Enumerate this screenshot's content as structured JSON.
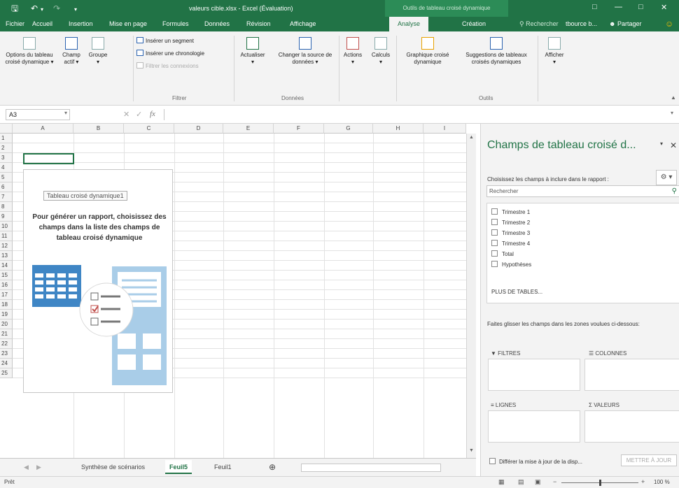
{
  "title": {
    "window_title": "valeurs cible.xlsx - Excel (Évaluation)",
    "contextual_label": "Outils de tableau croisé dynamique"
  },
  "tabs": [
    "Fichier",
    "Accueil",
    "Insertion",
    "Mise en page",
    "Formules",
    "Données",
    "Révision",
    "Affichage",
    "Analyse",
    "Création"
  ],
  "tell_me": "Rechercher",
  "user": "tbource b...",
  "share": "Partager",
  "ribbon": {
    "pivot_options": "Options du tableau croisé dynamique",
    "active_field": "Champ actif",
    "group": "Groupe",
    "insert_slicer": "Insérer un segment",
    "insert_timeline": "Insérer une chronologie",
    "filter_connections": "Filtrer les connexions",
    "filter_group": "Filtrer",
    "refresh": "Actualiser",
    "change_source": "Changer la source de données",
    "data_group": "Données",
    "actions": "Actions",
    "calculations": "Calculs",
    "pivot_chart": "Graphique croisé dynamique",
    "recommended": "Suggestions de tableaux croisés dynamiques",
    "tools_group": "Outils",
    "show": "Afficher"
  },
  "formula_bar": {
    "cell": "A3",
    "fx": "fx"
  },
  "columns": [
    "A",
    "B",
    "C",
    "D",
    "E",
    "F",
    "G",
    "H",
    "I"
  ],
  "rows": [
    "1",
    "2",
    "3",
    "4",
    "5",
    "6",
    "7",
    "8",
    "9",
    "10",
    "11",
    "12",
    "13",
    "14",
    "15",
    "16",
    "17",
    "18",
    "19",
    "20",
    "21",
    "22",
    "23",
    "24",
    "25"
  ],
  "pivot_placeholder": {
    "label": "Tableau croisé dynamique1",
    "instructions": "Pour générer un rapport, choisissez des champs dans la liste des champs de tableau croisé dynamique"
  },
  "sheets": [
    "Synthèse de scénarios",
    "Feuil5",
    "Feuil1"
  ],
  "status": {
    "ready": "Prêt",
    "zoom": "100 %"
  },
  "field_pane": {
    "title": "Champs de tableau croisé d...",
    "choose": "Choisissez les champs à inclure dans le rapport :",
    "search_placeholder": "Rechercher",
    "fields": [
      "Trimestre 1",
      "Trimestre 2",
      "Trimestre 3",
      "Trimestre 4",
      "Total",
      "Hypothèses"
    ],
    "more_tables": "PLUS DE TABLES...",
    "drag_hint": "Faites glisser les champs dans les zones voulues ci-dessous:",
    "zones": {
      "filters": "FILTRES",
      "columns": "COLONNES",
      "rows": "LIGNES",
      "values": "VALEURS"
    },
    "defer": "Différer la mise à jour de la disp...",
    "update": "METTRE À JOUR"
  },
  "colors": {
    "excel_green": "#217346",
    "accent_blue": "#4a90c8",
    "chart_red": "#c0504d"
  }
}
